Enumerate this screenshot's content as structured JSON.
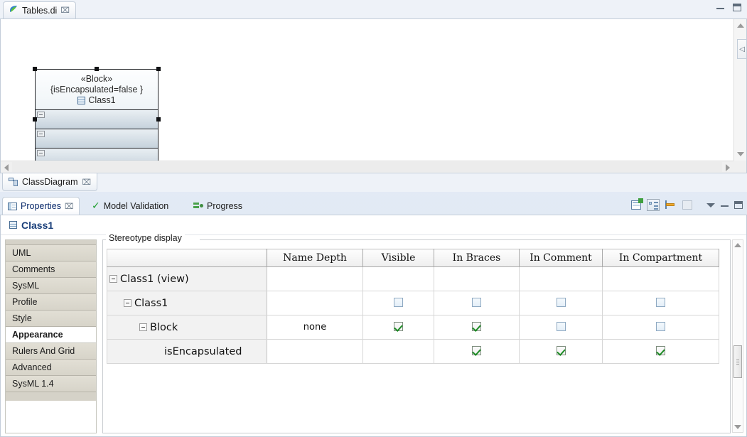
{
  "editor": {
    "tab": {
      "label": "Tables.di",
      "icon": "papyrus-icon",
      "close": "⌧"
    },
    "bottom_tab": {
      "label": "ClassDiagram",
      "icon": "class-diagram-icon",
      "close": "⌧"
    },
    "window_controls": {
      "minimize": "minimize-icon",
      "maximize": "maximize-icon"
    },
    "block": {
      "stereotype": "«Block»",
      "properties": "{isEncapsulated=false }",
      "name": "Class1",
      "compartments": [
        "",
        "",
        ""
      ]
    }
  },
  "properties_view": {
    "tabs": [
      {
        "label": "Properties",
        "icon": "properties-icon",
        "active": true,
        "close": "⌧"
      },
      {
        "label": "Model Validation",
        "icon": "validation-check-icon",
        "active": false
      },
      {
        "label": "Progress",
        "icon": "progress-icon",
        "active": false
      }
    ],
    "toolbar": [
      {
        "name": "new-tab-icon"
      },
      {
        "name": "show-tree-icon"
      },
      {
        "name": "pin-to-selection-icon"
      },
      {
        "name": "restore-default-icon"
      },
      {
        "name": "view-menu-icon"
      },
      {
        "name": "minimize-icon"
      },
      {
        "name": "maximize-icon"
      }
    ],
    "title": {
      "label": "Class1",
      "icon": "class-icon"
    },
    "side_tabs": [
      {
        "label": "UML",
        "selected": false
      },
      {
        "label": "Comments",
        "selected": false
      },
      {
        "label": "SysML",
        "selected": false
      },
      {
        "label": "Profile",
        "selected": false
      },
      {
        "label": "Style",
        "selected": false
      },
      {
        "label": "Appearance",
        "selected": true
      },
      {
        "label": "Rulers And Grid",
        "selected": false
      },
      {
        "label": "Advanced",
        "selected": false
      },
      {
        "label": "SysML 1.4",
        "selected": false
      }
    ],
    "group": {
      "legend": "Stereotype display"
    },
    "table": {
      "columns": [
        "",
        "Name Depth",
        "Visible",
        "In Braces",
        "In Comment",
        "In Compartment"
      ],
      "rows": [
        {
          "name": "Class1 (view)",
          "indent": 0,
          "expander": true,
          "name_depth": "",
          "visible": null,
          "in_braces": null,
          "in_comment": null,
          "in_compartment": null
        },
        {
          "name": "Class1",
          "indent": 1,
          "expander": true,
          "name_depth": "",
          "visible": false,
          "in_braces": false,
          "in_comment": false,
          "in_compartment": false
        },
        {
          "name": "Block",
          "indent": 2,
          "expander": true,
          "name_depth": "none",
          "visible": true,
          "in_braces": true,
          "in_comment": false,
          "in_compartment": false
        },
        {
          "name": "isEncapsulated",
          "indent": 3,
          "expander": false,
          "name_depth": "",
          "visible": null,
          "in_braces": true,
          "in_comment": true,
          "in_compartment": true
        }
      ]
    }
  },
  "colors": {
    "accent": "#1a3f7a",
    "check_green": "#1d8c25",
    "checkbox_border": "#8ea9c2",
    "block_fill": "#c6d2dc",
    "tab_bg": "#d7d4c9"
  }
}
